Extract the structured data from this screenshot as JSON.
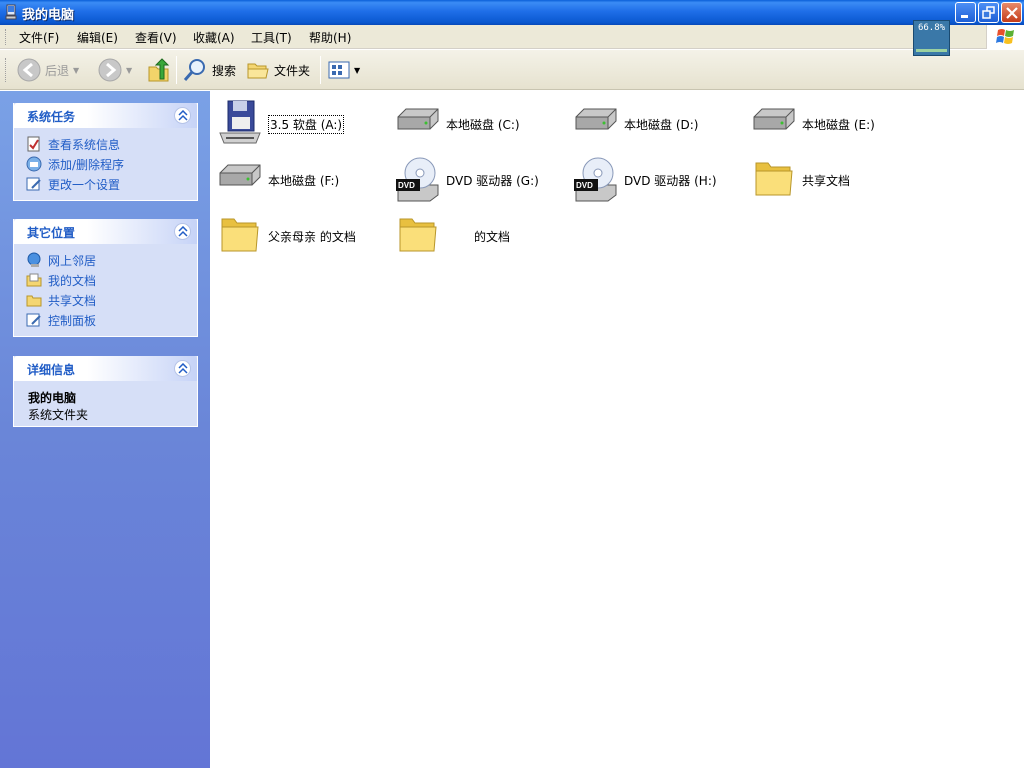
{
  "window": {
    "title": "我的电脑"
  },
  "zoom": {
    "text": "66.8%"
  },
  "menu": [
    "文件(F)",
    "编辑(E)",
    "查看(V)",
    "收藏(A)",
    "工具(T)",
    "帮助(H)"
  ],
  "toolbar": {
    "back": "后退",
    "search": "搜索",
    "folders": "文件夹"
  },
  "system_tasks": {
    "title": "系统任务",
    "items": [
      "查看系统信息",
      "添加/删除程序",
      "更改一个设置"
    ]
  },
  "other_places": {
    "title": "其它位置",
    "items": [
      "网上邻居",
      "我的文档",
      "共享文档",
      "控制面板"
    ]
  },
  "details": {
    "title": "详细信息",
    "name": "我的电脑",
    "type": "系统文件夹"
  },
  "drives": [
    {
      "label": "3.5 软盘 (A:)",
      "icon": "floppy-icon"
    },
    {
      "label": "本地磁盘 (C:)",
      "icon": "hard-disk-icon"
    },
    {
      "label": "本地磁盘 (D:)",
      "icon": "hard-disk-icon"
    },
    {
      "label": "本地磁盘 (E:)",
      "icon": "hard-disk-icon"
    },
    {
      "label": "本地磁盘 (F:)",
      "icon": "hard-disk-icon"
    },
    {
      "label": "DVD 驱动器 (G:)",
      "icon": "dvd-drive-icon"
    },
    {
      "label": "DVD 驱动器 (H:)",
      "icon": "dvd-drive-icon"
    },
    {
      "label": "共享文档",
      "icon": "folder-icon"
    },
    {
      "label": "父亲母亲 的文档",
      "icon": "folder-icon"
    },
    {
      "label": "的文档",
      "icon": "folder-icon"
    }
  ],
  "colors": {
    "title_bar": "#0a58d0",
    "task_pane": "#6a86d8",
    "link": "#215dc6"
  }
}
